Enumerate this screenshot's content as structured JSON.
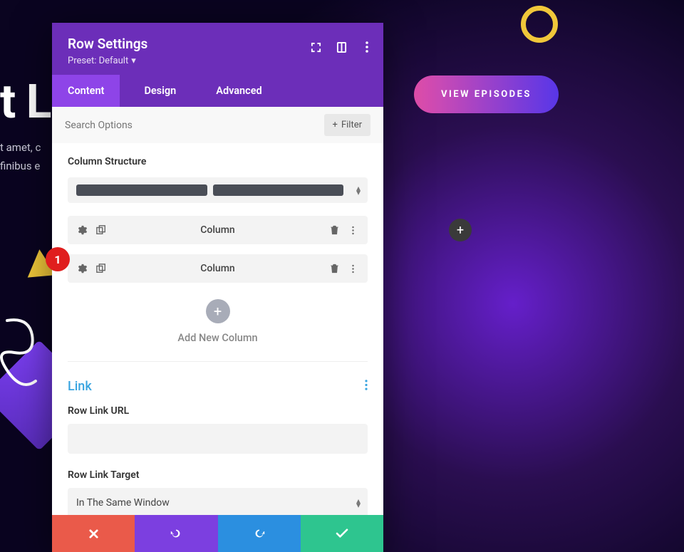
{
  "background": {
    "heading_fragment": "t L",
    "paragraph_line1": "t amet, c",
    "paragraph_line2": "finibus e"
  },
  "cta": {
    "label": "VIEW EPISODES"
  },
  "add_bg": "+",
  "modal": {
    "title": "Row Settings",
    "preset": "Preset: Default",
    "tabs": {
      "content": "Content",
      "design": "Design",
      "advanced": "Advanced"
    },
    "search": {
      "placeholder": "Search Options",
      "filter": "Filter"
    },
    "column_structure_label": "Column Structure",
    "columns": [
      {
        "label": "Column"
      },
      {
        "label": "Column"
      }
    ],
    "add_new_column": "Add New Column",
    "link": {
      "heading": "Link",
      "url_label": "Row Link URL",
      "url_value": "",
      "target_label": "Row Link Target",
      "target_value": "In The Same Window"
    }
  },
  "step_badge": "1"
}
